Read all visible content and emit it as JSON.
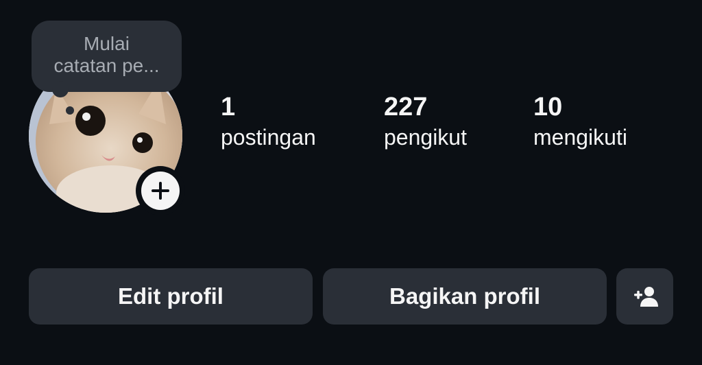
{
  "note": {
    "line1": "Mulai",
    "line2": "catatan pe..."
  },
  "stats": {
    "posts": {
      "count": "1",
      "label": "postingan"
    },
    "followers": {
      "count": "227",
      "label": "pengikut"
    },
    "following": {
      "count": "10",
      "label": "mengikuti"
    }
  },
  "buttons": {
    "edit": "Edit profil",
    "share": "Bagikan profil"
  },
  "icons": {
    "add_story": "plus-icon",
    "add_user": "add-person-icon",
    "avatar": "cat-photo"
  },
  "colors": {
    "background": "#0b0f14",
    "button": "#2a2f37",
    "text": "#f5f5f5",
    "muted": "#a7acb3"
  }
}
